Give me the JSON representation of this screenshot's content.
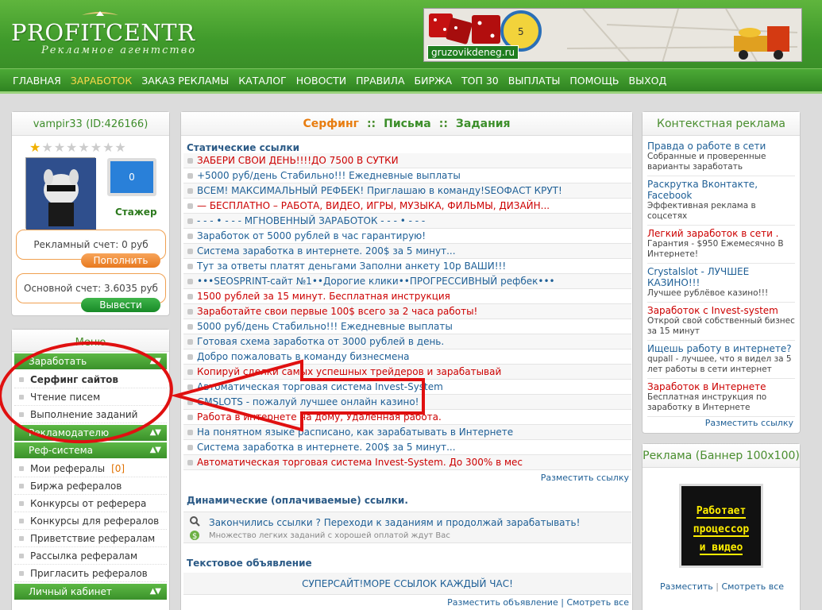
{
  "header": {
    "logo": "PROFITCENTR",
    "logo_sub": "Рекламное агентство",
    "banner_url": "gruzovikdeneg.ru"
  },
  "nav": [
    "ГЛАВНАЯ",
    "ЗАРАБОТОК",
    "ЗАКАЗ РЕКЛАМЫ",
    "КАТАЛОГ",
    "НОВОСТИ",
    "ПРАВИЛА",
    "БИРЖА",
    "ТОП 30",
    "ВЫПЛАТЫ",
    "ПОМОЩЬ",
    "ВЫХОД"
  ],
  "nav_active": "ЗАРАБОТОК",
  "user": {
    "name": "vampir33",
    "id": "(ID:426166)",
    "stars_total": 8,
    "stars_filled": 1,
    "monitor_value": "0",
    "rank": "Стажер",
    "ad_account": "Рекламный счет: 0 руб",
    "topup_label": "Пополнить",
    "main_account": "Основной счет: 3.6035 руб",
    "withdraw_label": "Вывести"
  },
  "menu": {
    "title": "Меню",
    "earn": "Заработать",
    "earn_items": [
      "Серфинг сайтов",
      "Чтение писем",
      "Выполнение заданий"
    ],
    "ads": "Рекламодателю",
    "ref": "Реф-система",
    "ref_items": [
      "Мои рефералы",
      "Биржа рефералов",
      "Конкурсы от реферера",
      "Конкурсы для рефералов",
      "Приветствие рефералам",
      "Рассылка рефералам",
      "Пригласить рефералов"
    ],
    "ref_count": "[0]",
    "cabinet": "Личный кабинет"
  },
  "main": {
    "tabs": [
      "Серфинг",
      "Письма",
      "Задания"
    ],
    "tab_sep": "::",
    "static_title": "Статические ссылки",
    "links": [
      {
        "text": "ЗАБЕРИ СВОИ ДЕНЬ!!!!ДО 7500 В СУТКИ",
        "color": "red"
      },
      {
        "text": "+5000 руб/день Стабильно!!! Ежедневные выплаты",
        "color": "blue"
      },
      {
        "text": "ВСЕМ! МАКСИМАЛЬНЫЙ РЕФБЕК! Приглашаю в команду!SEOФАСТ КРУТ!",
        "color": "blue"
      },
      {
        "text": "— БЕСПЛАТНО – РАБОТА, ВИДЕО, ИГРЫ, МУЗЫКА, ФИЛЬМЫ, ДИЗАЙН...",
        "color": "red"
      },
      {
        "text": "- - - • - - - МГНОВЕННЫЙ ЗАРАБОТОК - - - • - - -",
        "color": "blue"
      },
      {
        "text": "Заработок от 5000 рублей в час гарантирую!",
        "color": "blue"
      },
      {
        "text": "Система заработка в интернете. 200$ за 5 минут...",
        "color": "blue"
      },
      {
        "text": "Тут за ответы платят деньгами Заполни анкету 10р ВАШИ!!!",
        "color": "blue"
      },
      {
        "text": "•••SEOSPRINT-сайт №1••Дорогие клики••ПРОГРЕССИВНЫЙ рефбек•••",
        "color": "blue"
      },
      {
        "text": "1500 рублей за 15 минут. Бесплатная инструкция",
        "color": "red"
      },
      {
        "text": "Заработайте свои первые 100$ всего за 2 часа работы!",
        "color": "red"
      },
      {
        "text": "5000 руб/день Стабильно!!! Ежедневные выплаты",
        "color": "blue"
      },
      {
        "text": "Готовая схема заработка от 3000 рублей в день.",
        "color": "blue"
      },
      {
        "text": "Добро пожаловать в команду бизнесмена",
        "color": "blue"
      },
      {
        "text": "Копируй сделки самых успешных трейдеров и зарабатывай",
        "color": "red"
      },
      {
        "text": "Автоматическая торговая система Invest-System",
        "color": "blue"
      },
      {
        "text": "GMSLOTS - пожалуй лучшее онлайн казино!",
        "color": "blue"
      },
      {
        "text": "Работа в интернете на дому, Удаленная работа.",
        "color": "red"
      },
      {
        "text": "На понятном языке расписано, как зарабатывать в Интернете",
        "color": "blue"
      },
      {
        "text": "Система заработка в интернете. 200$ за 5 минут...",
        "color": "blue"
      },
      {
        "text": "Автоматическая торговая система Invest-System. До 300% в мес",
        "color": "red"
      }
    ],
    "place_link": "Разместить ссылку",
    "dynamic_title": "Динамические (оплачиваемые) ссылки.",
    "dynamic_text": "Закончились ссылки ? Переходи к заданиям и продолжай зарабатывать!",
    "dynamic_sub": "Множество легких заданий с хорошей оплатой ждут Вас",
    "text_ad_title": "Текстовое объявление",
    "text_ad": "СУПЕРСАЙТ!МОРЕ ССЫЛОК КАЖДЫЙ ЧАС!",
    "place_ad": "Разместить объявление",
    "sep": "|",
    "see_all": "Смотреть все"
  },
  "context": {
    "title": "Контекстная реклама",
    "items": [
      {
        "t": "Правда о работе в сети",
        "d": "Собранные и проверенные варианты заработать",
        "red": false
      },
      {
        "t": "Раскрутка Вконтакте, Facebook",
        "d": "Эффективная реклама в соцсетях",
        "red": false
      },
      {
        "t": "Легкий заработок в сети .",
        "d": "Гарантия - $950 Ежемесячно В Интернете!",
        "red": true
      },
      {
        "t": "Crystalslot - ЛУЧШЕЕ КАЗИНО!!!",
        "d": "Лучшее рублёвое казино!!!",
        "red": false
      },
      {
        "t": "Заработок с Invest-system",
        "d": "Открой свой собственный бизнес за 15 минут",
        "red": true
      },
      {
        "t": "Ищешь работу в интернете?",
        "d": "qupall - лучшее, что я видел за 5 лет работы в сети интернет",
        "red": false
      },
      {
        "t": "Заработок в Интернете",
        "d": "Бесплатная инструкция по заработку в Интернете",
        "red": true
      }
    ],
    "place": "Разместить ссылку"
  },
  "banner_box": {
    "title": "Реклама (Баннер 100x100)",
    "lines": [
      "Работает",
      "процессор",
      "и видео"
    ],
    "place": "Разместить",
    "sep": "|",
    "see_all": "Смотреть все"
  },
  "colors": {
    "green": "#3f9a2b",
    "link_blue": "#1e5f96",
    "link_red": "#cc0000",
    "orange": "#e87d10"
  }
}
